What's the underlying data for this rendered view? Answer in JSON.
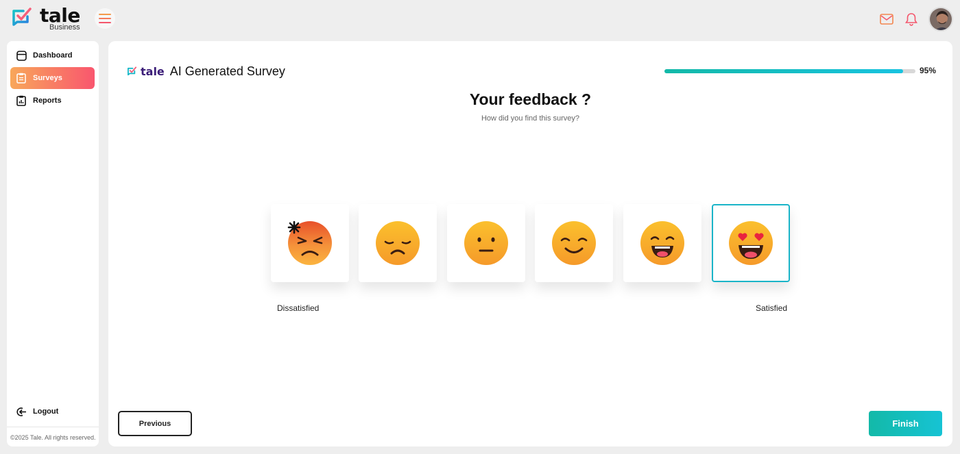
{
  "brand": {
    "name": "tale",
    "sub": "Business",
    "mini": "tale"
  },
  "colors": {
    "accent": "#16bccd",
    "sidebar_active_from": "#f8a75a",
    "sidebar_active_to": "#f9566e"
  },
  "topbar": {
    "icons": [
      "menu-icon",
      "mail-icon",
      "bell-icon",
      "avatar"
    ]
  },
  "sidebar": {
    "items": [
      {
        "label": "Dashboard",
        "icon": "dashboard-icon",
        "active": false
      },
      {
        "label": "Surveys",
        "icon": "clipboard-icon",
        "active": true
      },
      {
        "label": "Reports",
        "icon": "report-icon",
        "active": false
      }
    ],
    "logout": "Logout",
    "copyright": "©2025 Tale. All rights reserved."
  },
  "survey": {
    "title": "AI Generated Survey",
    "progress_value": 0.95,
    "progress_label": "95%",
    "question": "Your feedback ?",
    "subtitle": "How did you find this survey?",
    "options": [
      {
        "id": "angry",
        "selected": false
      },
      {
        "id": "sad",
        "selected": false
      },
      {
        "id": "neutral",
        "selected": false
      },
      {
        "id": "smile",
        "selected": false
      },
      {
        "id": "happy",
        "selected": false
      },
      {
        "id": "love",
        "selected": true
      }
    ],
    "scale_left": "Dissatisfied",
    "scale_right": "Satisfied"
  },
  "buttons": {
    "previous": "Previous",
    "finish": "Finish"
  }
}
